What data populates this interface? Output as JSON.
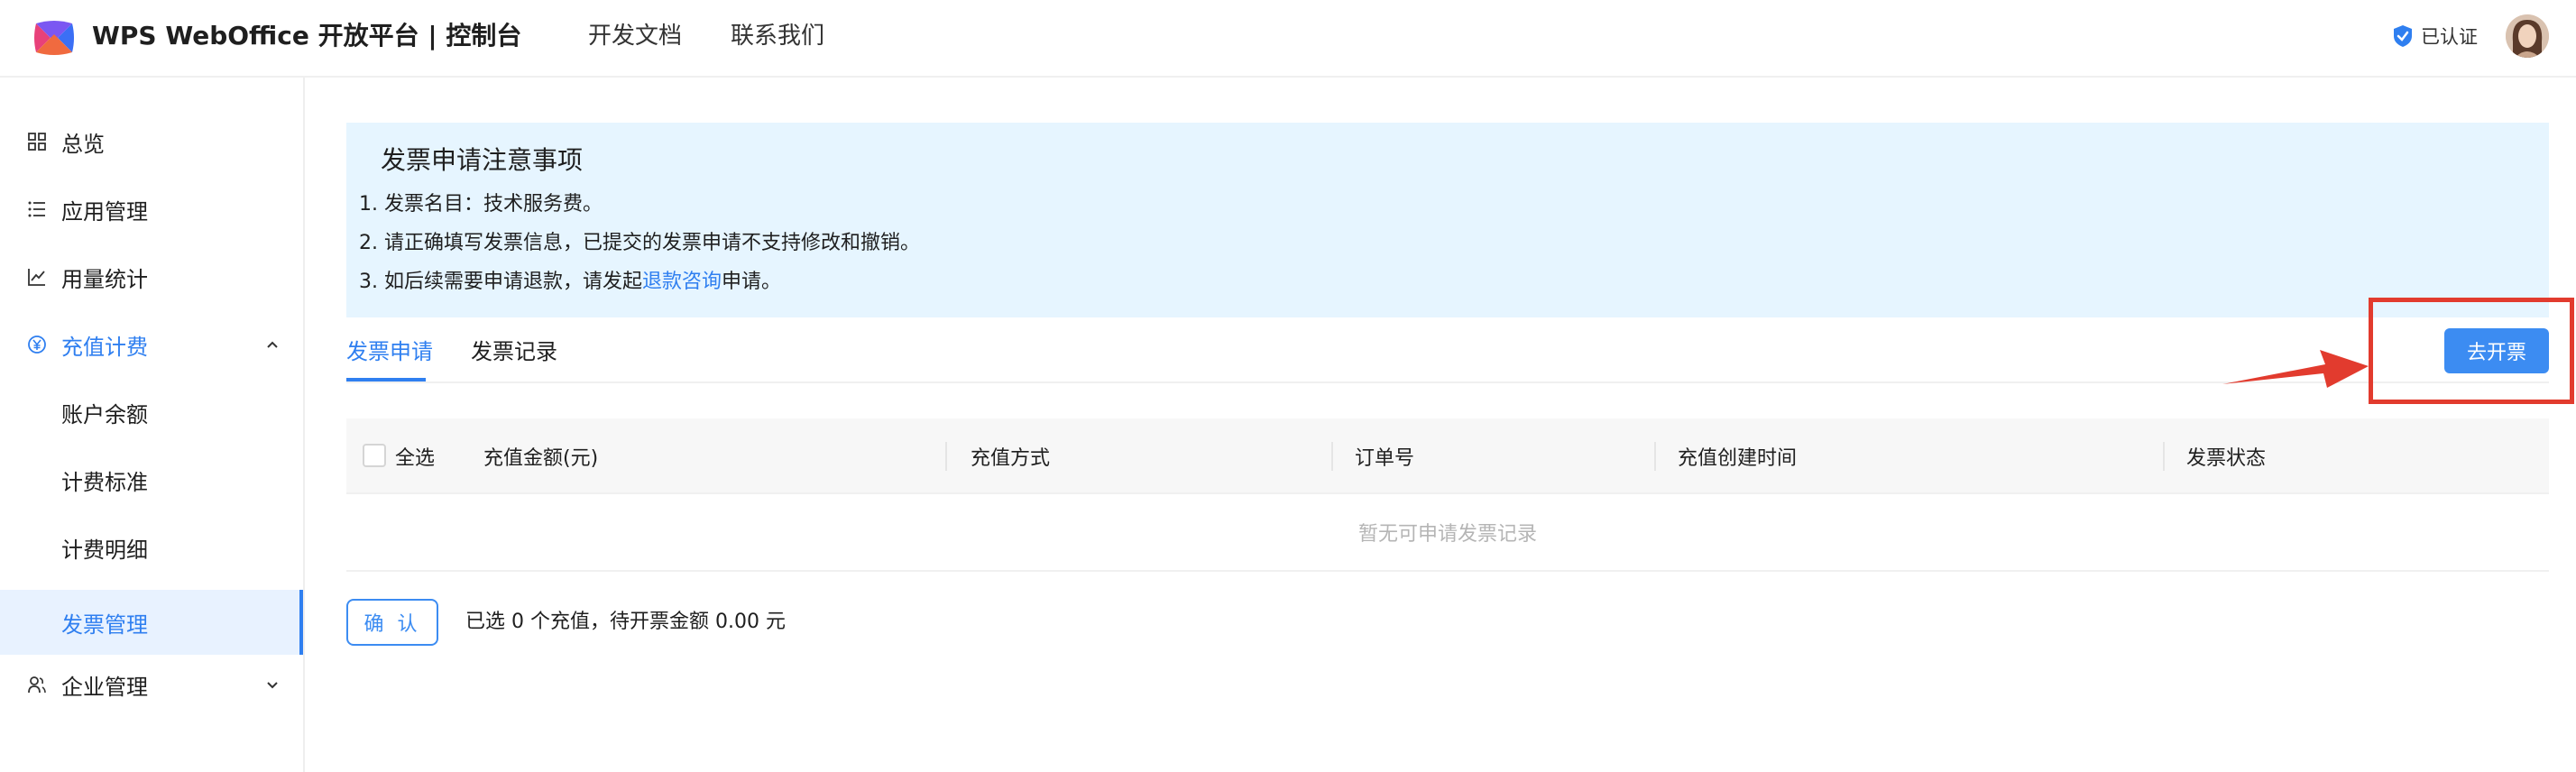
{
  "header": {
    "brand": "WPS WebOffice 开放平台 | 控制台",
    "nav": [
      "开发文档",
      "联系我们"
    ],
    "verified_label": "已认证"
  },
  "sidebar": {
    "items": [
      {
        "label": "总览",
        "icon": "grid-icon"
      },
      {
        "label": "应用管理",
        "icon": "list-icon"
      },
      {
        "label": "用量统计",
        "icon": "line-chart-icon"
      },
      {
        "label": "充值计费",
        "icon": "yen-icon",
        "expanded": true
      },
      {
        "label": "账户余额"
      },
      {
        "label": "计费标准"
      },
      {
        "label": "计费明细"
      },
      {
        "label": "发票管理",
        "selected": true
      },
      {
        "label": "企业管理",
        "icon": "users-icon",
        "expanded": false
      }
    ]
  },
  "notice": {
    "title": "发票申请注意事项",
    "line1": "1. 发票名目：技术服务费。",
    "line2": "2. 请正确填写发票信息，已提交的发票申请不支持修改和撤销。",
    "line3_prefix": "3. 如后续需要申请退款，请发起",
    "line3_link": "退款咨询",
    "line3_suffix": "申请。"
  },
  "tabs": [
    {
      "label": "发票申请",
      "active": true
    },
    {
      "label": "发票记录",
      "active": false
    }
  ],
  "invoice_button": "去开票",
  "table": {
    "select_all": "全选",
    "columns": [
      "充值金额(元)",
      "充值方式",
      "订单号",
      "充值创建时间",
      "发票状态"
    ],
    "empty_text": "暂无可申请发票记录"
  },
  "footer": {
    "confirm": "确 认",
    "summary": "已选 0 个充值，待开票金额 0.00 元"
  },
  "colors": {
    "accent": "#2f7ff0",
    "notice_bg": "#e6f5ff",
    "annotation": "#e23b2e"
  }
}
